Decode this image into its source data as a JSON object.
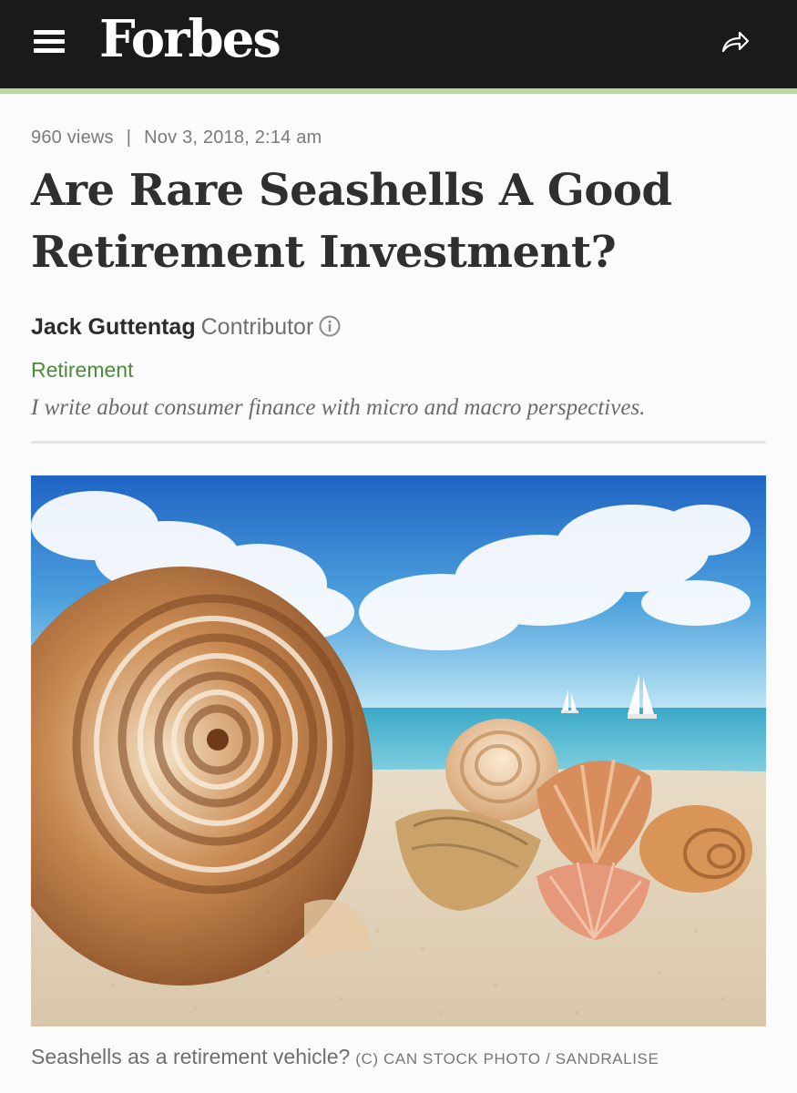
{
  "header": {
    "logo": "Forbes",
    "background_color": "#1a1a1a",
    "accent_color": "#b7d9a4",
    "menu_icon": "hamburger-menu-icon",
    "share_icon": "share-arrow-icon"
  },
  "article": {
    "views": "960 views",
    "separator": "|",
    "date": "Nov 3, 2018,",
    "time": "2:14 am",
    "title": "Are Rare Seashells A Good Retirement Investment?",
    "author": "Jack Guttentag",
    "author_role": "Contributor",
    "info_icon": "info-circle-icon",
    "section": "Retirement",
    "section_color": "#4f8a3b",
    "author_tagline": "I write about consumer finance with micro and macro perspectives."
  },
  "image": {
    "caption": "Seashells as a retirement vehicle?",
    "credit": "(C) CAN STOCK PHOTO / SANDRALISE"
  }
}
